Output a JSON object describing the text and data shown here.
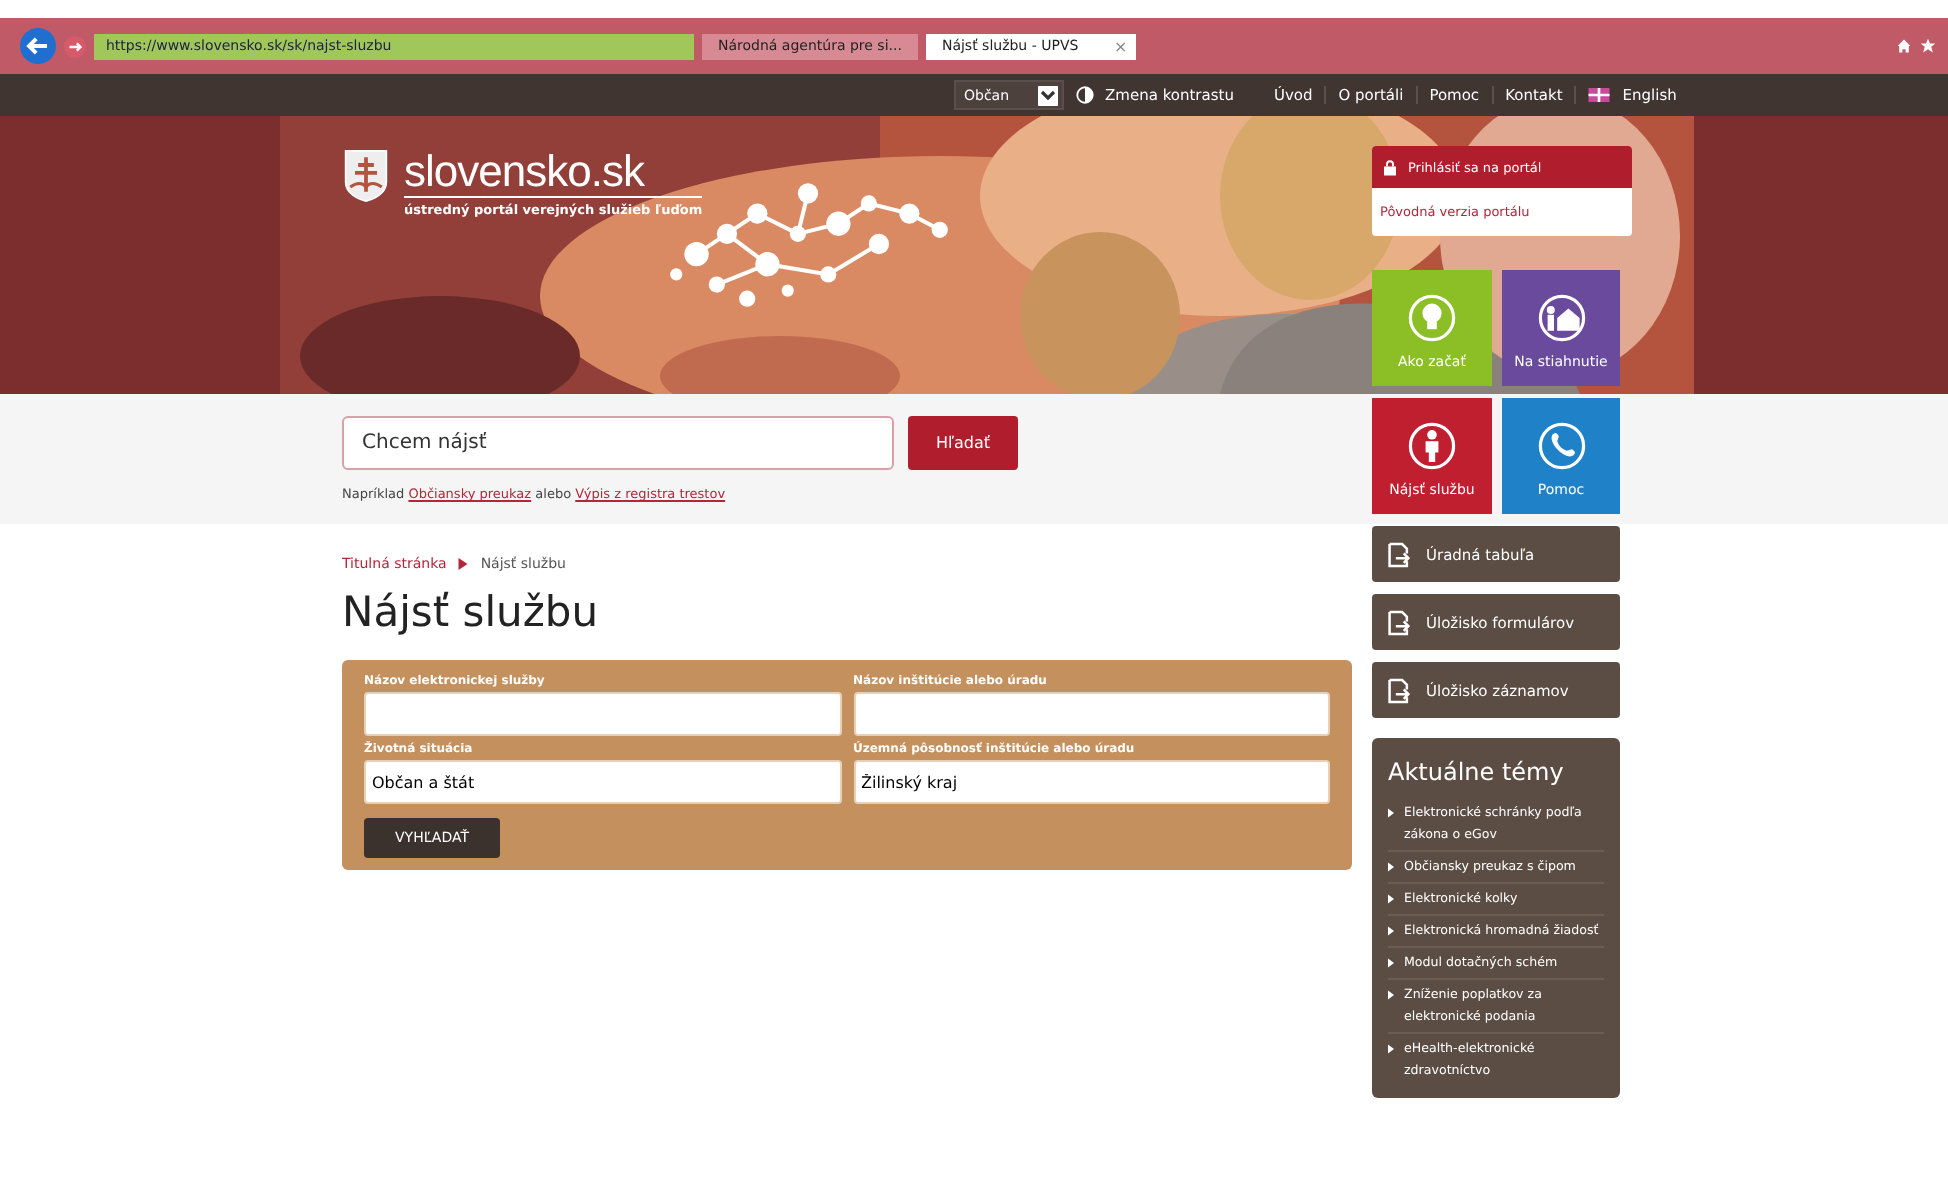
{
  "browser": {
    "url": "https://www.slovensko.sk/sk/najst-sluzbu",
    "tabs": [
      {
        "title": "Národná agentúra pre si...",
        "selected": false
      },
      {
        "title": "Nájsť službu - UPVS",
        "selected": true
      }
    ],
    "close_tab": "×"
  },
  "topbar": {
    "role": "Občan",
    "contrast": "Zmena kontrastu",
    "links": [
      "Úvod",
      "O portáli",
      "Pomoc",
      "Kontakt"
    ],
    "language": "English"
  },
  "header": {
    "logo": "slovensko.sk",
    "tagline": "ústredný portál verejných služieb ľuďom"
  },
  "login": {
    "button": "Prihlásiť sa na portál",
    "old_version": "Pôvodná verzia portálu"
  },
  "tiles": [
    {
      "label": "Ako začať",
      "color": "#8cbf26",
      "kind": "bulb"
    },
    {
      "label": "Na stiahnutie",
      "color": "#6a4a9c",
      "kind": "download"
    },
    {
      "label": "Nájsť službu",
      "color": "#c01f2f",
      "kind": "person"
    },
    {
      "label": "Pomoc",
      "color": "#1f82c8",
      "kind": "phone"
    }
  ],
  "search": {
    "placeholder": "Chcem nájsť",
    "button": "Hľadať",
    "hint_prefix": "Napríklad",
    "example_1": "Občiansky preukaz",
    "hint_middle": "alebo",
    "example_2": "Výpis z registra trestov"
  },
  "breadcrumb": [
    {
      "label": "Titulná stránka",
      "current": false
    },
    {
      "label": "Nájsť službu",
      "current": true
    }
  ],
  "title": "Nájsť službu",
  "form": {
    "fields": [
      {
        "label": "Názov elektronickej služby"
      },
      {
        "label": "Názov inštitúcie alebo úradu"
      },
      {
        "label": "Životná situácia",
        "value": "Občan a štát"
      },
      {
        "label": "Územná pôsobnosť inštitúcie alebo úradu",
        "value": "Žilinský kraj"
      }
    ],
    "button": "VYHĽADAŤ"
  },
  "side_links": [
    "Úradná tabuľa",
    "Úložisko formulárov",
    "Úložisko záznamov"
  ],
  "topics": {
    "title": "Aktuálne témy",
    "items": [
      "Elektronické schránky podľa zákona o eGov",
      "Občiansky preukaz s čipom",
      "Elektronické kolky",
      "Elektronická hromadná žiadosť",
      "Modul dotačných schém",
      "Zníženie poplatkov za elektronické podania",
      "eHealth-elektronické zdravotníctvo"
    ]
  }
}
